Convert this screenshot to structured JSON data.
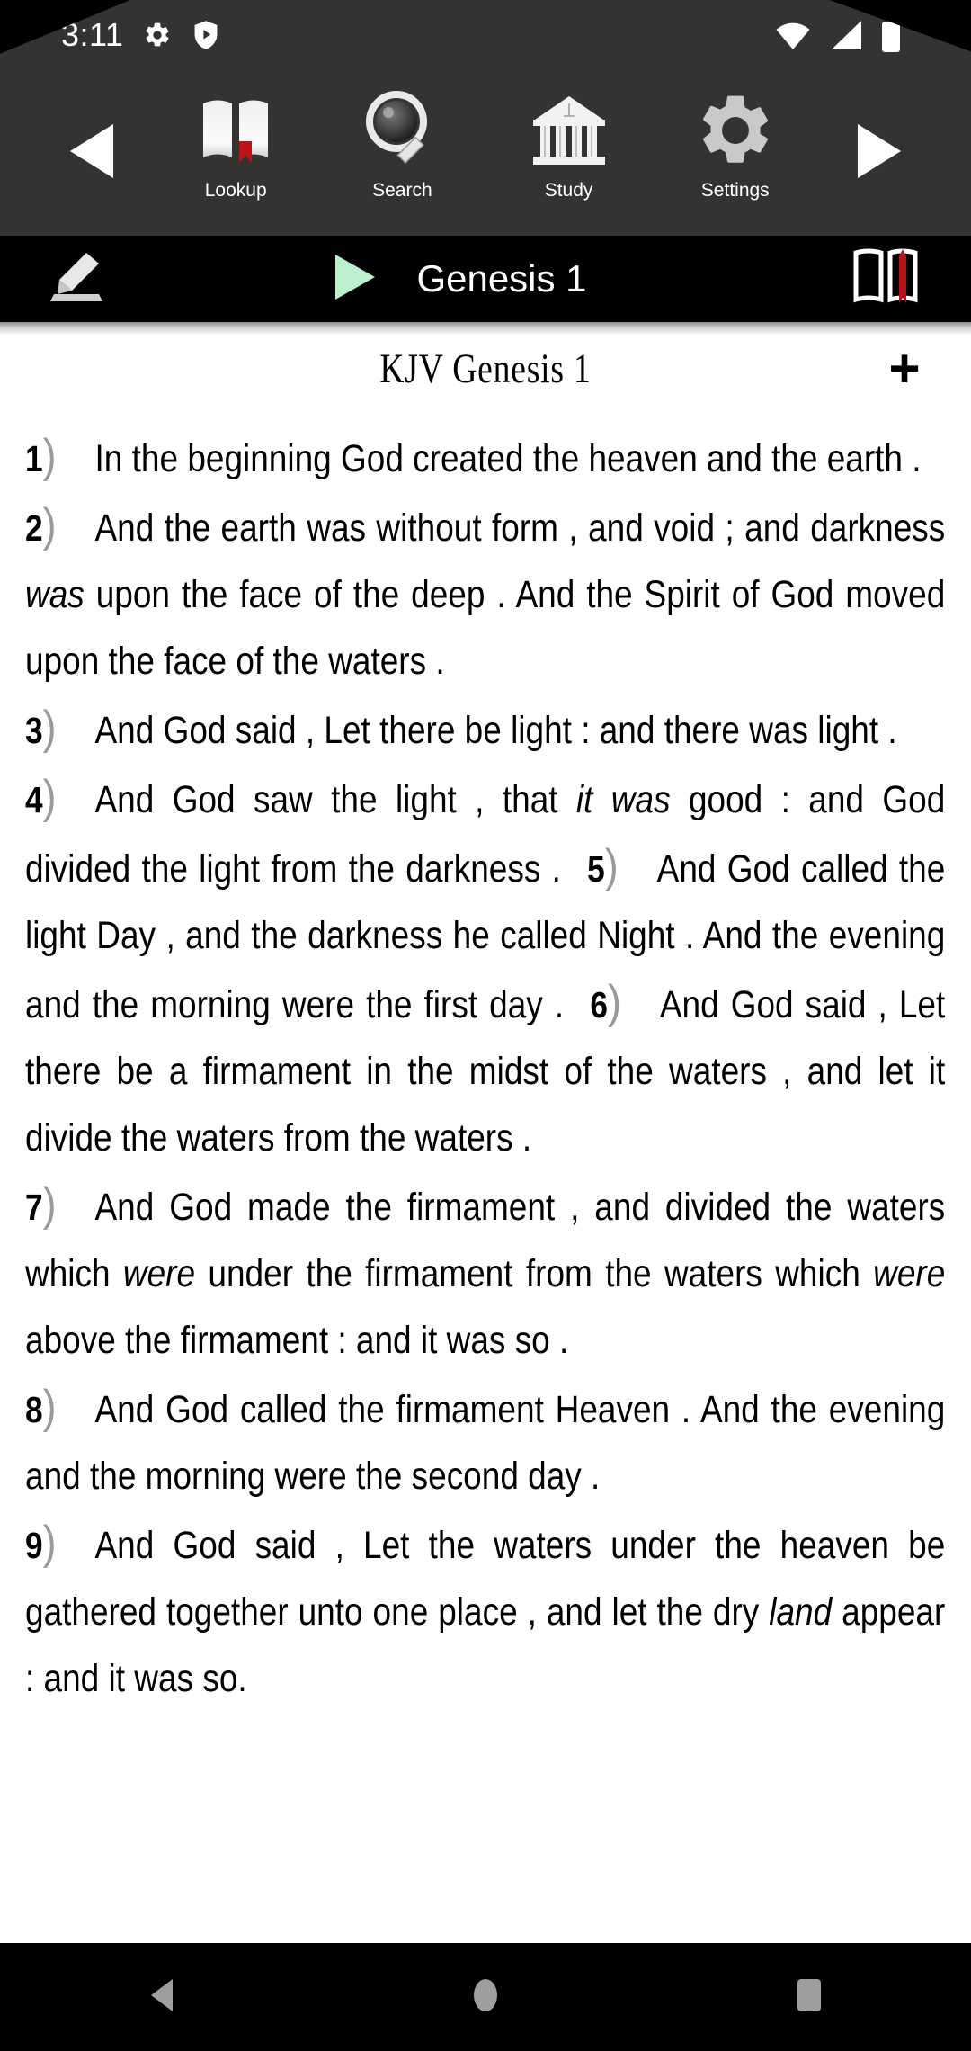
{
  "status_bar": {
    "time": "3:11",
    "icons_left": [
      "gear-icon",
      "shield-play-icon"
    ],
    "icons_right": [
      "wifi-icon",
      "cellular-signal-icon",
      "battery-icon"
    ],
    "background": "#333333",
    "foreground": "#ffffff"
  },
  "toolbar": {
    "background": "#333333",
    "prev_icon": "left-triangle-icon",
    "next_icon": "right-triangle-icon",
    "items": [
      {
        "label": "Lookup",
        "icon": "open-book-icon"
      },
      {
        "label": "Search",
        "icon": "magnifier-icon"
      },
      {
        "label": "Study",
        "icon": "temple-icon"
      },
      {
        "label": "Settings",
        "icon": "gear-icon"
      }
    ]
  },
  "chapter_bar": {
    "background": "#000000",
    "note_icon": "pencil-write-icon",
    "play_icon": "play-triangle-icon",
    "play_color": "#bdf0cf",
    "title": "Genesis 1",
    "bookmark_icon": "open-book-bookmark-icon",
    "bookmark_accent": "#b4141a"
  },
  "page_header": {
    "title": "KJV Genesis 1",
    "add_label": "+",
    "add_icon": "plus-icon"
  },
  "scripture": {
    "translation": "KJV",
    "book": "Genesis",
    "chapter": "1",
    "verses": [
      {
        "num": "1",
        "text_pre": "In the beginning God created the heaven and the earth .",
        "italics": []
      },
      {
        "num": "2",
        "text_pre": "And the earth was without form , and void ; and darkness ",
        "italic": "was",
        "text_post": " upon the face of the deep . And the Spirit of God moved upon the face of the waters ."
      },
      {
        "num": "3",
        "text_pre": "And God said , Let there be light : and there was light .",
        "italics": []
      },
      {
        "num": "4",
        "text_pre": "And God saw the light , that ",
        "italic": "it was",
        "text_post": " good : and God divided the light from the darkness ."
      },
      {
        "num": "5",
        "text_pre": "And God called the light Day , and the darkness he called Night . And the evening and the morning were the first day .",
        "italics": []
      },
      {
        "num": "6",
        "text_pre": "And God said , Let there be a firmament in the midst of the waters , and let it divide the waters from the waters .",
        "italics": []
      },
      {
        "num": "7",
        "text_pre": "And God made the firmament , and divided the waters which ",
        "italic": "were",
        "text_mid": " under the firmament from the waters which ",
        "italic2": "were",
        "text_post": " above the firmament : and it was so ."
      },
      {
        "num": "8",
        "text_pre": "And God called the firmament Heaven . And the evening and the morning were the second day .",
        "italics": []
      },
      {
        "num": "9",
        "text_pre": "And God said , Let the waters under the heaven be gathered together unto one place , and let the dry ",
        "italic": "land",
        "text_post": " appear : and it was so."
      }
    ],
    "paragraphs": [
      {
        "id": "p1",
        "verse_nums": [
          "1"
        ]
      },
      {
        "id": "p2",
        "verse_nums": [
          "2"
        ]
      },
      {
        "id": "p3",
        "verse_nums": [
          "3"
        ]
      },
      {
        "id": "p4",
        "verse_nums": [
          "4",
          "5",
          "6"
        ]
      },
      {
        "id": "p5",
        "verse_nums": [
          "7"
        ]
      },
      {
        "id": "p6",
        "verse_nums": [
          "8"
        ]
      },
      {
        "id": "p7",
        "verse_nums": [
          "9"
        ]
      }
    ]
  },
  "system_nav": {
    "background": "#000000",
    "back_icon": "back-triangle-icon",
    "home_icon": "home-circle-icon",
    "recents_icon": "recents-square-icon",
    "tint": "#9e9e9e"
  }
}
